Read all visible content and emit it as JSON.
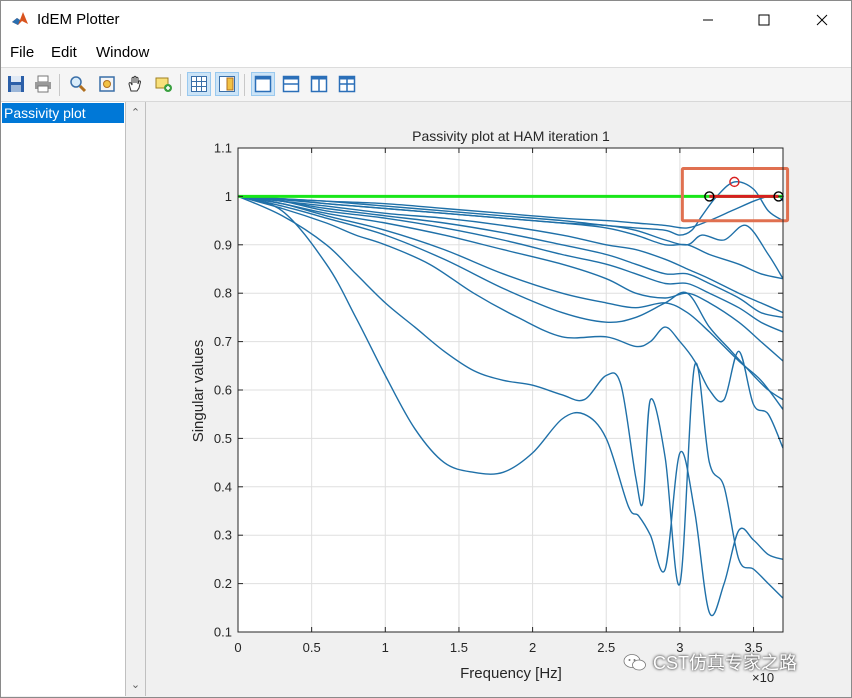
{
  "window": {
    "title": "IdEM Plotter"
  },
  "menu": {
    "file": "File",
    "edit": "Edit",
    "window": "Window"
  },
  "toolbar": {
    "icons": [
      "save-icon",
      "print-icon",
      "zoom-icon",
      "fit-icon",
      "pan-hand-icon",
      "data-tip-icon",
      "grid-icon",
      "legend-icon",
      "layout-single-icon",
      "layout-horizontal-icon",
      "layout-vertical-icon",
      "layout-quad-icon"
    ]
  },
  "sidebar": {
    "items": [
      {
        "label": "Passivity plot",
        "selected": true
      }
    ]
  },
  "colors": {
    "curve": "#1f70a8",
    "limit": "#19e619",
    "violation": "#d81f1f",
    "highlight": "#e07050",
    "selection": "#0078d7"
  },
  "watermark": {
    "text": "CST仿真专家之路"
  },
  "chart_data": {
    "type": "line",
    "title": "Passivity plot at HAM iteration 1",
    "xlabel": "Frequency [Hz]",
    "ylabel": "Singular values",
    "xlim": [
      0,
      3.7
    ],
    "ylim": [
      0.1,
      1.1
    ],
    "x_multiplier": "×10",
    "xticks": [
      0,
      0.5,
      1,
      1.5,
      2,
      2.5,
      3,
      3.5
    ],
    "xtick_labels": [
      "0",
      "0.5",
      "1",
      "1.5",
      "2",
      "2.5",
      "3",
      "3.5"
    ],
    "yticks": [
      0.1,
      0.2,
      0.3,
      0.4,
      0.5,
      0.6,
      0.7,
      0.8,
      0.9,
      1,
      1.1
    ],
    "ytick_labels": [
      "0.1",
      "0.2",
      "0.3",
      "0.4",
      "0.5",
      "0.6",
      "0.7",
      "0.8",
      "0.9",
      "1",
      "1.1"
    ],
    "grid": true,
    "limit_line": {
      "y": 1.0,
      "x": [
        0,
        3.7
      ]
    },
    "violation": {
      "x": [
        3.2,
        3.37,
        3.67
      ],
      "y": [
        1.0,
        1.03,
        1.0
      ],
      "band": [
        3.2,
        3.67
      ]
    },
    "series": [
      {
        "x": [
          0,
          0.3,
          0.6,
          0.8,
          1.0,
          1.2,
          1.4,
          1.6,
          1.8,
          2.0,
          2.2,
          2.35,
          2.5,
          2.65,
          2.72,
          2.8,
          2.9,
          3.0,
          3.1,
          3.2,
          3.3,
          3.4,
          3.5,
          3.6,
          3.7
        ],
        "y": [
          1,
          0.97,
          0.86,
          0.75,
          0.63,
          0.52,
          0.45,
          0.43,
          0.43,
          0.47,
          0.54,
          0.55,
          0.5,
          0.36,
          0.34,
          0.3,
          0.23,
          0.47,
          0.35,
          0.14,
          0.2,
          0.31,
          0.29,
          0.26,
          0.25
        ]
      },
      {
        "x": [
          0,
          0.3,
          0.6,
          0.8,
          1.0,
          1.2,
          1.4,
          1.6,
          1.8,
          2.0,
          2.2,
          2.35,
          2.5,
          2.6,
          2.7,
          2.75,
          2.8,
          2.9,
          3.0,
          3.1,
          3.2,
          3.3,
          3.4,
          3.5,
          3.6,
          3.7
        ],
        "y": [
          1,
          0.96,
          0.9,
          0.84,
          0.78,
          0.73,
          0.68,
          0.64,
          0.62,
          0.61,
          0.59,
          0.58,
          0.63,
          0.61,
          0.42,
          0.37,
          0.58,
          0.46,
          0.2,
          0.65,
          0.45,
          0.4,
          0.25,
          0.23,
          0.2,
          0.17
        ]
      },
      {
        "x": [
          0,
          0.3,
          0.6,
          0.8,
          1.0,
          1.3,
          1.6,
          1.9,
          2.2,
          2.5,
          2.7,
          2.8,
          2.9,
          3.0,
          3.1,
          3.2,
          3.3,
          3.4,
          3.5,
          3.6,
          3.7
        ],
        "y": [
          1,
          0.975,
          0.945,
          0.92,
          0.9,
          0.86,
          0.8,
          0.75,
          0.71,
          0.71,
          0.69,
          0.7,
          0.73,
          0.7,
          0.66,
          0.6,
          0.58,
          0.68,
          0.57,
          0.55,
          0.48
        ]
      },
      {
        "x": [
          0,
          0.3,
          0.6,
          1.0,
          1.4,
          1.8,
          2.2,
          2.5,
          2.7,
          2.9,
          3.05,
          3.2,
          3.35,
          3.5,
          3.6,
          3.7
        ],
        "y": [
          1,
          0.98,
          0.955,
          0.92,
          0.87,
          0.81,
          0.76,
          0.74,
          0.75,
          0.78,
          0.8,
          0.73,
          0.68,
          0.63,
          0.6,
          0.58
        ]
      },
      {
        "x": [
          0,
          0.3,
          0.6,
          1.0,
          1.4,
          1.8,
          2.2,
          2.5,
          2.7,
          2.9,
          3.05,
          3.2,
          3.4,
          3.55,
          3.7
        ],
        "y": [
          1,
          0.985,
          0.96,
          0.93,
          0.89,
          0.84,
          0.8,
          0.78,
          0.77,
          0.78,
          0.76,
          0.72,
          0.66,
          0.62,
          0.56
        ]
      },
      {
        "x": [
          0,
          0.3,
          0.6,
          1.0,
          1.4,
          1.8,
          2.2,
          2.5,
          2.7,
          2.9,
          3.05,
          3.2,
          3.4,
          3.55,
          3.7
        ],
        "y": [
          1,
          0.985,
          0.965,
          0.945,
          0.92,
          0.89,
          0.86,
          0.83,
          0.8,
          0.79,
          0.8,
          0.78,
          0.74,
          0.7,
          0.66
        ]
      },
      {
        "x": [
          0,
          0.3,
          0.6,
          1.0,
          1.4,
          1.8,
          2.2,
          2.5,
          2.7,
          2.9,
          3.05,
          3.2,
          3.4,
          3.55,
          3.7
        ],
        "y": [
          1,
          0.99,
          0.97,
          0.955,
          0.935,
          0.91,
          0.88,
          0.86,
          0.84,
          0.82,
          0.82,
          0.8,
          0.77,
          0.74,
          0.72
        ]
      },
      {
        "x": [
          0,
          0.3,
          0.6,
          1.0,
          1.4,
          1.8,
          2.2,
          2.5,
          2.7,
          2.9,
          3.05,
          3.2,
          3.4,
          3.55,
          3.7
        ],
        "y": [
          1,
          0.99,
          0.975,
          0.96,
          0.945,
          0.925,
          0.9,
          0.88,
          0.86,
          0.84,
          0.84,
          0.82,
          0.79,
          0.76,
          0.75
        ]
      },
      {
        "x": [
          0,
          0.3,
          0.6,
          1.0,
          1.4,
          1.8,
          2.2,
          2.5,
          2.7,
          2.9,
          3.05,
          3.2,
          3.4,
          3.55,
          3.7
        ],
        "y": [
          1,
          0.99,
          0.98,
          0.965,
          0.955,
          0.94,
          0.92,
          0.9,
          0.89,
          0.87,
          0.85,
          0.83,
          0.8,
          0.78,
          0.76
        ]
      },
      {
        "x": [
          0,
          0.3,
          0.6,
          1.0,
          1.4,
          1.8,
          2.2,
          2.5,
          2.7,
          2.9,
          3.05,
          3.2,
          3.4,
          3.55,
          3.7
        ],
        "y": [
          1,
          0.993,
          0.985,
          0.975,
          0.965,
          0.955,
          0.945,
          0.935,
          0.92,
          0.9,
          0.9,
          0.88,
          0.86,
          0.84,
          0.83
        ]
      },
      {
        "x": [
          0,
          0.3,
          0.6,
          1.0,
          1.4,
          1.8,
          2.2,
          2.5,
          2.7,
          2.9,
          3.05,
          3.15,
          3.3,
          3.45,
          3.6,
          3.7
        ],
        "y": [
          1,
          0.995,
          0.985,
          0.975,
          0.965,
          0.955,
          0.945,
          0.94,
          0.93,
          0.91,
          0.9,
          0.92,
          0.91,
          0.94,
          0.88,
          0.83
        ]
      },
      {
        "x": [
          0,
          0.3,
          0.6,
          1.0,
          1.4,
          1.8,
          2.2,
          2.5,
          2.7,
          2.9,
          3.0,
          3.08,
          3.15,
          3.25,
          3.37,
          3.5,
          3.6,
          3.7
        ],
        "y": [
          1,
          0.995,
          0.99,
          0.98,
          0.97,
          0.96,
          0.95,
          0.94,
          0.935,
          0.93,
          0.92,
          0.93,
          0.96,
          1.0,
          1.03,
          1.015,
          0.97,
          0.95
        ]
      },
      {
        "x": [
          0,
          0.3,
          0.6,
          1.0,
          1.4,
          1.8,
          2.2,
          2.5,
          2.7,
          2.9,
          3.05,
          3.2,
          3.35,
          3.5,
          3.6,
          3.67,
          3.7
        ],
        "y": [
          1,
          0.995,
          0.99,
          0.985,
          0.975,
          0.965,
          0.955,
          0.95,
          0.945,
          0.94,
          0.935,
          0.95,
          0.97,
          0.99,
          1.0,
          1.0,
          0.99
        ]
      }
    ]
  }
}
